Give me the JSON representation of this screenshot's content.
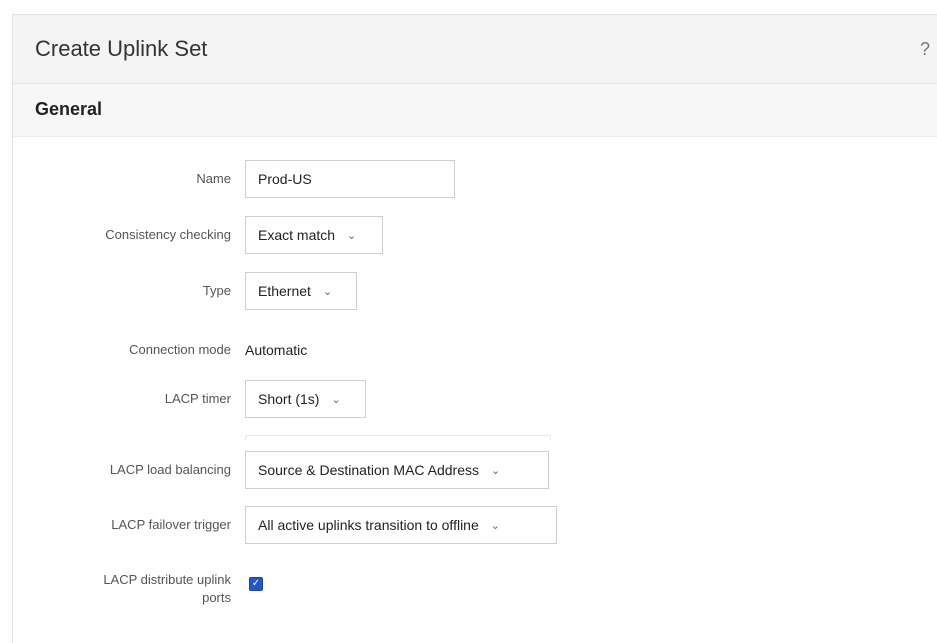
{
  "dialog": {
    "title": "Create Uplink Set",
    "help": "?"
  },
  "section": {
    "title": "General"
  },
  "fields": {
    "name": {
      "label": "Name",
      "value": "Prod-US"
    },
    "consistency": {
      "label": "Consistency checking",
      "value": "Exact match"
    },
    "type": {
      "label": "Type",
      "value": "Ethernet"
    },
    "connection_mode": {
      "label": "Connection mode",
      "value": "Automatic"
    },
    "lacp_timer": {
      "label": "LACP timer",
      "value": "Short (1s)"
    },
    "lacp_load_balancing": {
      "label": "LACP load balancing",
      "value": "Source & Destination MAC Address"
    },
    "lacp_failover_trigger": {
      "label": "LACP failover trigger",
      "value": "All active uplinks transition to offline"
    },
    "lacp_distribute": {
      "label_line1": "LACP distribute uplink",
      "label_line2": "ports",
      "checked": true,
      "check_glyph": "✓"
    }
  },
  "icons": {
    "chevron": "⌄",
    "help": "help-icon"
  }
}
